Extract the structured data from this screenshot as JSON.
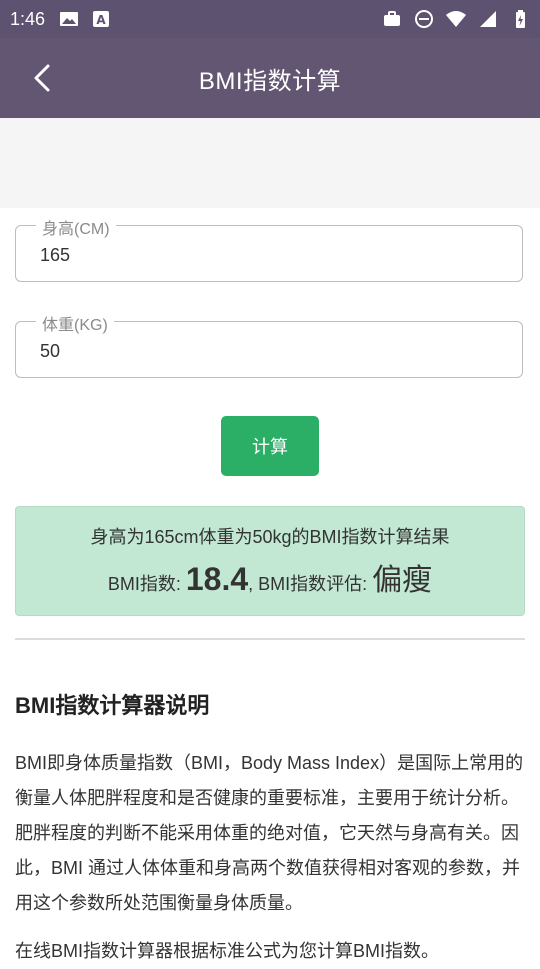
{
  "statusbar": {
    "time": "1:46"
  },
  "appbar": {
    "title": "BMI指数计算"
  },
  "form": {
    "height_label": "身高(CM)",
    "height_value": "165",
    "weight_label": "体重(KG)",
    "weight_value": "50",
    "calc_label": "计算"
  },
  "result": {
    "summary": "身高为165cm体重为50kg的BMI指数计算结果",
    "bmi_prefix": "BMI指数: ",
    "bmi_value": "18.4",
    "eval_prefix": ", BMI指数评估: ",
    "eval_value": "偏瘦"
  },
  "info": {
    "title": "BMI指数计算器说明",
    "para1": "BMI即身体质量指数（BMI，Body Mass Index）是国际上常用的衡量人体肥胖程度和是否健康的重要标准，主要用于统计分析。肥胖程度的判断不能采用体重的绝对值，它天然与身高有关。因此，BMI 通过人体体重和身高两个数值获得相对客观的参数，并用这个参数所处范围衡量身体质量。",
    "para2": "在线BMI指数计算器根据标准公式为您计算BMI指数。"
  },
  "colors": {
    "statusbar": "#5d5270",
    "appbar": "#625673",
    "button": "#2bae66",
    "result_bg": "#c2e8d3"
  }
}
